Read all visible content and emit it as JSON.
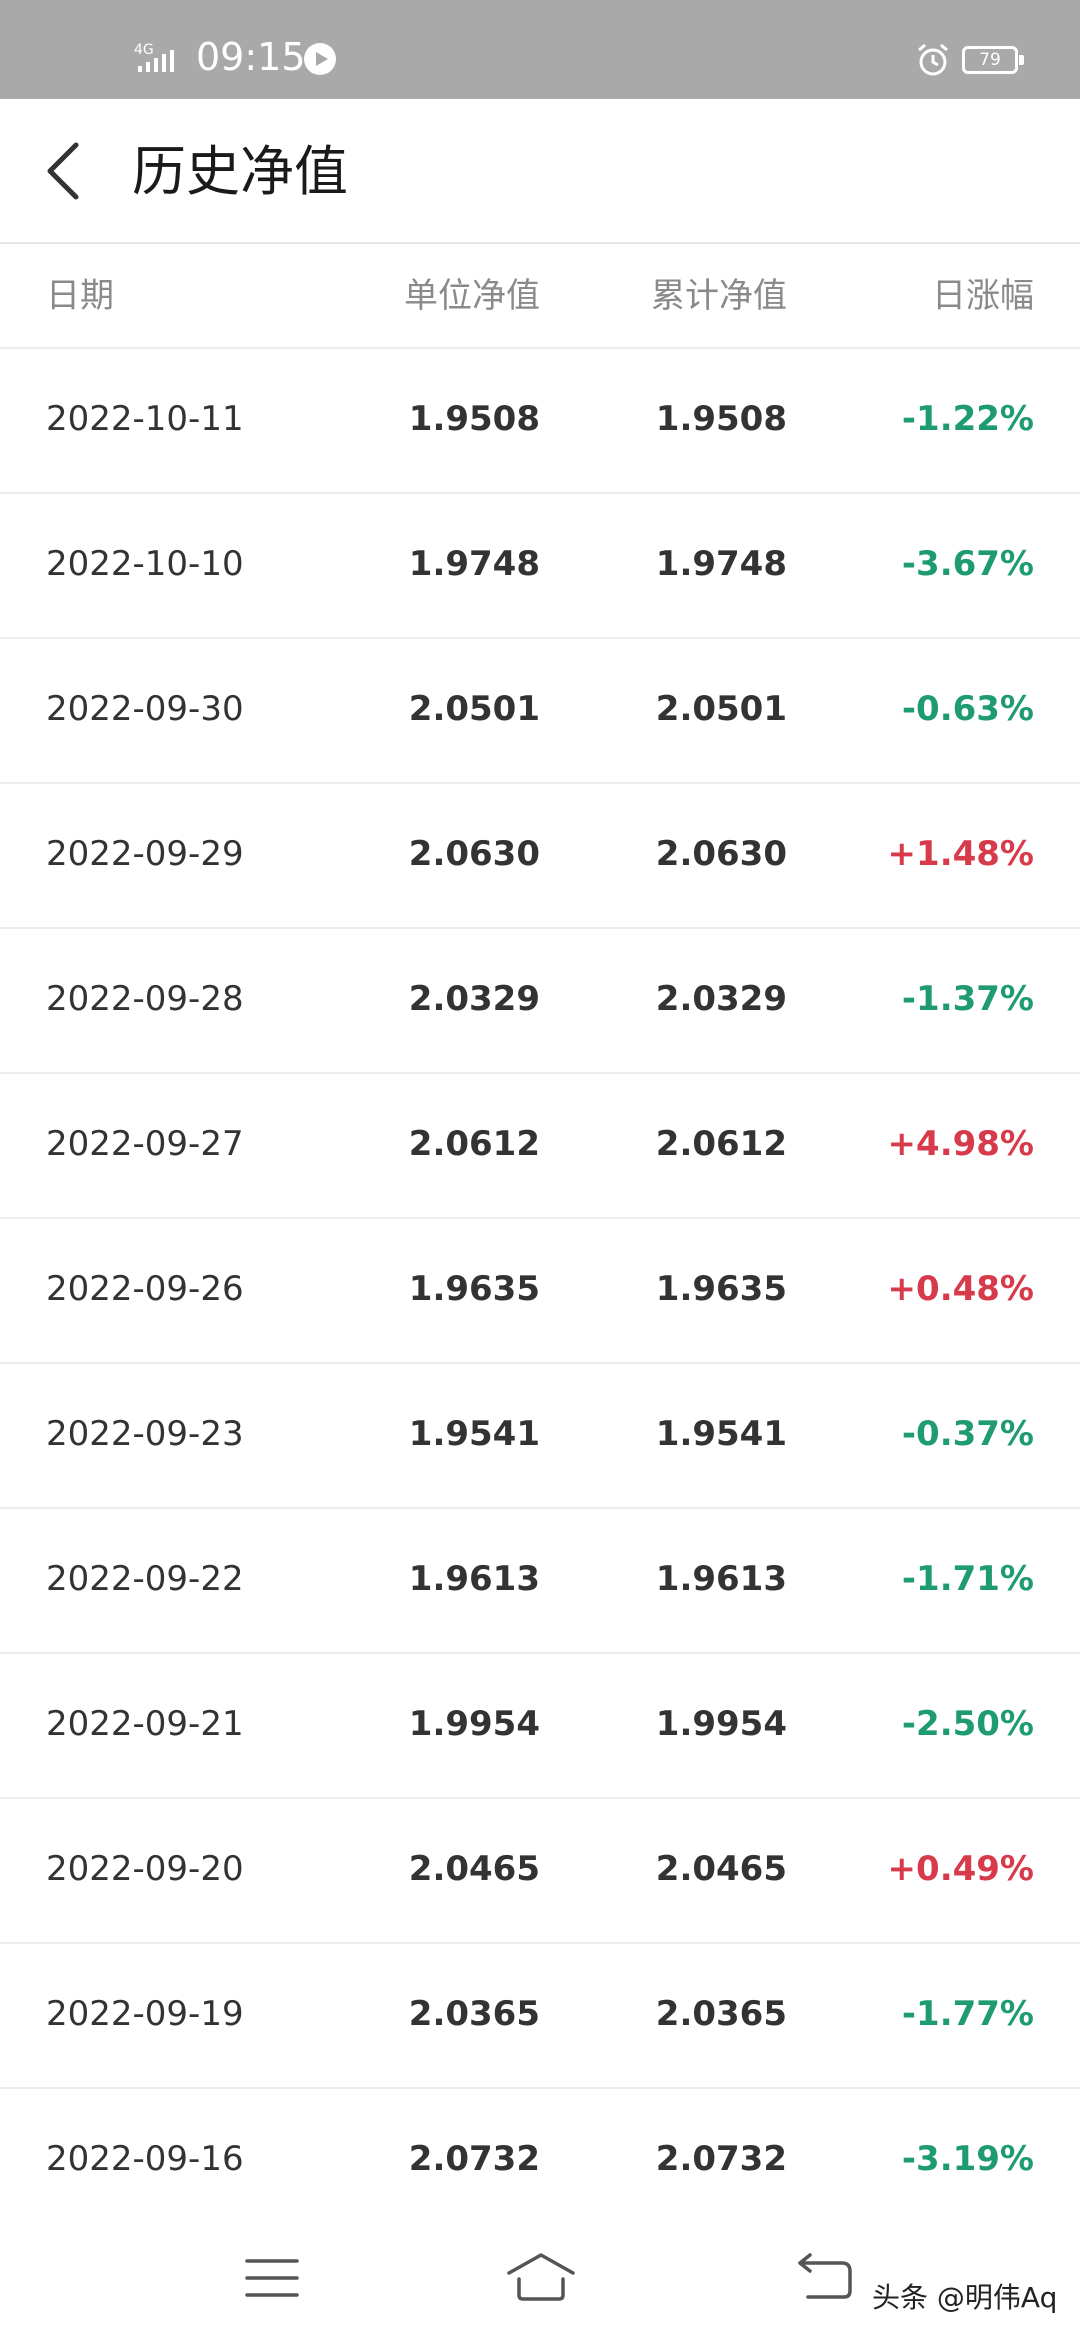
{
  "status_bar": {
    "network": "4G",
    "time": "09:15",
    "battery": "79",
    "icons": [
      "signal-icon",
      "play-icon",
      "alarm-icon",
      "battery-icon"
    ]
  },
  "header": {
    "title": "历史净值",
    "back_icon": "chevron-left-icon"
  },
  "table": {
    "columns": [
      "日期",
      "单位净值",
      "累计净值",
      "日涨幅"
    ],
    "colors": {
      "up": "#d73a4a",
      "down": "#1e9b6f"
    },
    "rows": [
      {
        "date": "2022-10-11",
        "unit": "1.9508",
        "cum": "1.9508",
        "chg": "-1.22%"
      },
      {
        "date": "2022-10-10",
        "unit": "1.9748",
        "cum": "1.9748",
        "chg": "-3.67%"
      },
      {
        "date": "2022-09-30",
        "unit": "2.0501",
        "cum": "2.0501",
        "chg": "-0.63%"
      },
      {
        "date": "2022-09-29",
        "unit": "2.0630",
        "cum": "2.0630",
        "chg": "+1.48%"
      },
      {
        "date": "2022-09-28",
        "unit": "2.0329",
        "cum": "2.0329",
        "chg": "-1.37%"
      },
      {
        "date": "2022-09-27",
        "unit": "2.0612",
        "cum": "2.0612",
        "chg": "+4.98%"
      },
      {
        "date": "2022-09-26",
        "unit": "1.9635",
        "cum": "1.9635",
        "chg": "+0.48%"
      },
      {
        "date": "2022-09-23",
        "unit": "1.9541",
        "cum": "1.9541",
        "chg": "-0.37%"
      },
      {
        "date": "2022-09-22",
        "unit": "1.9613",
        "cum": "1.9613",
        "chg": "-1.71%"
      },
      {
        "date": "2022-09-21",
        "unit": "1.9954",
        "cum": "1.9954",
        "chg": "-2.50%"
      },
      {
        "date": "2022-09-20",
        "unit": "2.0465",
        "cum": "2.0465",
        "chg": "+0.49%"
      },
      {
        "date": "2022-09-19",
        "unit": "2.0365",
        "cum": "2.0365",
        "chg": "-1.77%"
      },
      {
        "date": "2022-09-16",
        "unit": "2.0732",
        "cum": "2.0732",
        "chg": "-3.19%"
      }
    ]
  },
  "nav_bar": {
    "icons": [
      "menu-icon",
      "home-icon",
      "back-icon"
    ]
  },
  "watermark": "头条 @明伟Aq"
}
